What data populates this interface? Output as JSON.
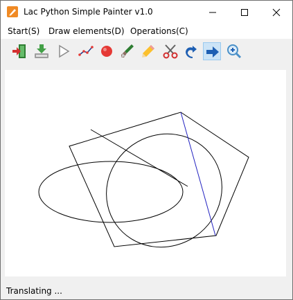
{
  "window": {
    "title": "Lac Python Simple Painter v1.0"
  },
  "menu": {
    "items": [
      {
        "label": "Start(S)"
      },
      {
        "label": "Draw elements(D)"
      },
      {
        "label": "Operations(C)"
      }
    ]
  },
  "toolbar": {
    "tools": [
      {
        "icon": "exit-icon"
      },
      {
        "icon": "save-download-icon"
      },
      {
        "icon": "play-triangle-icon"
      },
      {
        "icon": "polyline-icon"
      },
      {
        "icon": "red-circle-icon"
      },
      {
        "icon": "brush-icon"
      },
      {
        "icon": "pencil-icon"
      },
      {
        "icon": "scissors-icon"
      },
      {
        "icon": "rotate-arrow-icon"
      },
      {
        "icon": "move-right-arrow-icon"
      },
      {
        "icon": "zoom-in-icon"
      }
    ],
    "active_tool": "move-right-arrow-icon"
  },
  "status": {
    "text": "Translating ..."
  },
  "colors": {
    "accent_selected_line": "#2020c0",
    "shape_stroke": "#000000",
    "canvas_background": "#ffffff"
  }
}
